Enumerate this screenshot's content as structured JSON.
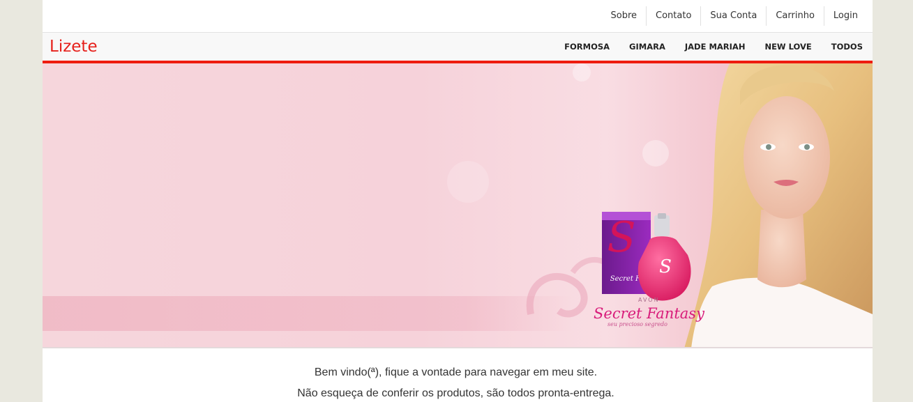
{
  "top_nav": {
    "items": [
      "Sobre",
      "Contato",
      "Sua Conta",
      "Carrinho",
      "Login"
    ]
  },
  "brand": "Lizete",
  "main_nav": {
    "items": [
      "FORMOSA",
      "GIMARA",
      "JADE MARIAH",
      "NEW LOVE",
      "TODOS"
    ]
  },
  "hero": {
    "product_brand": "AVON",
    "product_name": "Secret Fantasy",
    "product_tagline": "seu precioso segredo",
    "box_text": "Secret Fa"
  },
  "welcome": {
    "line1": "Bem vindo(ª), fique a vontade para navegar em meu site.",
    "line2": "Não esqueça de conferir os produtos, são todos pronta-entrega."
  },
  "colors": {
    "accent": "#ee1c0f",
    "brand": "#e6201b",
    "page_bg": "#e9e8df"
  }
}
